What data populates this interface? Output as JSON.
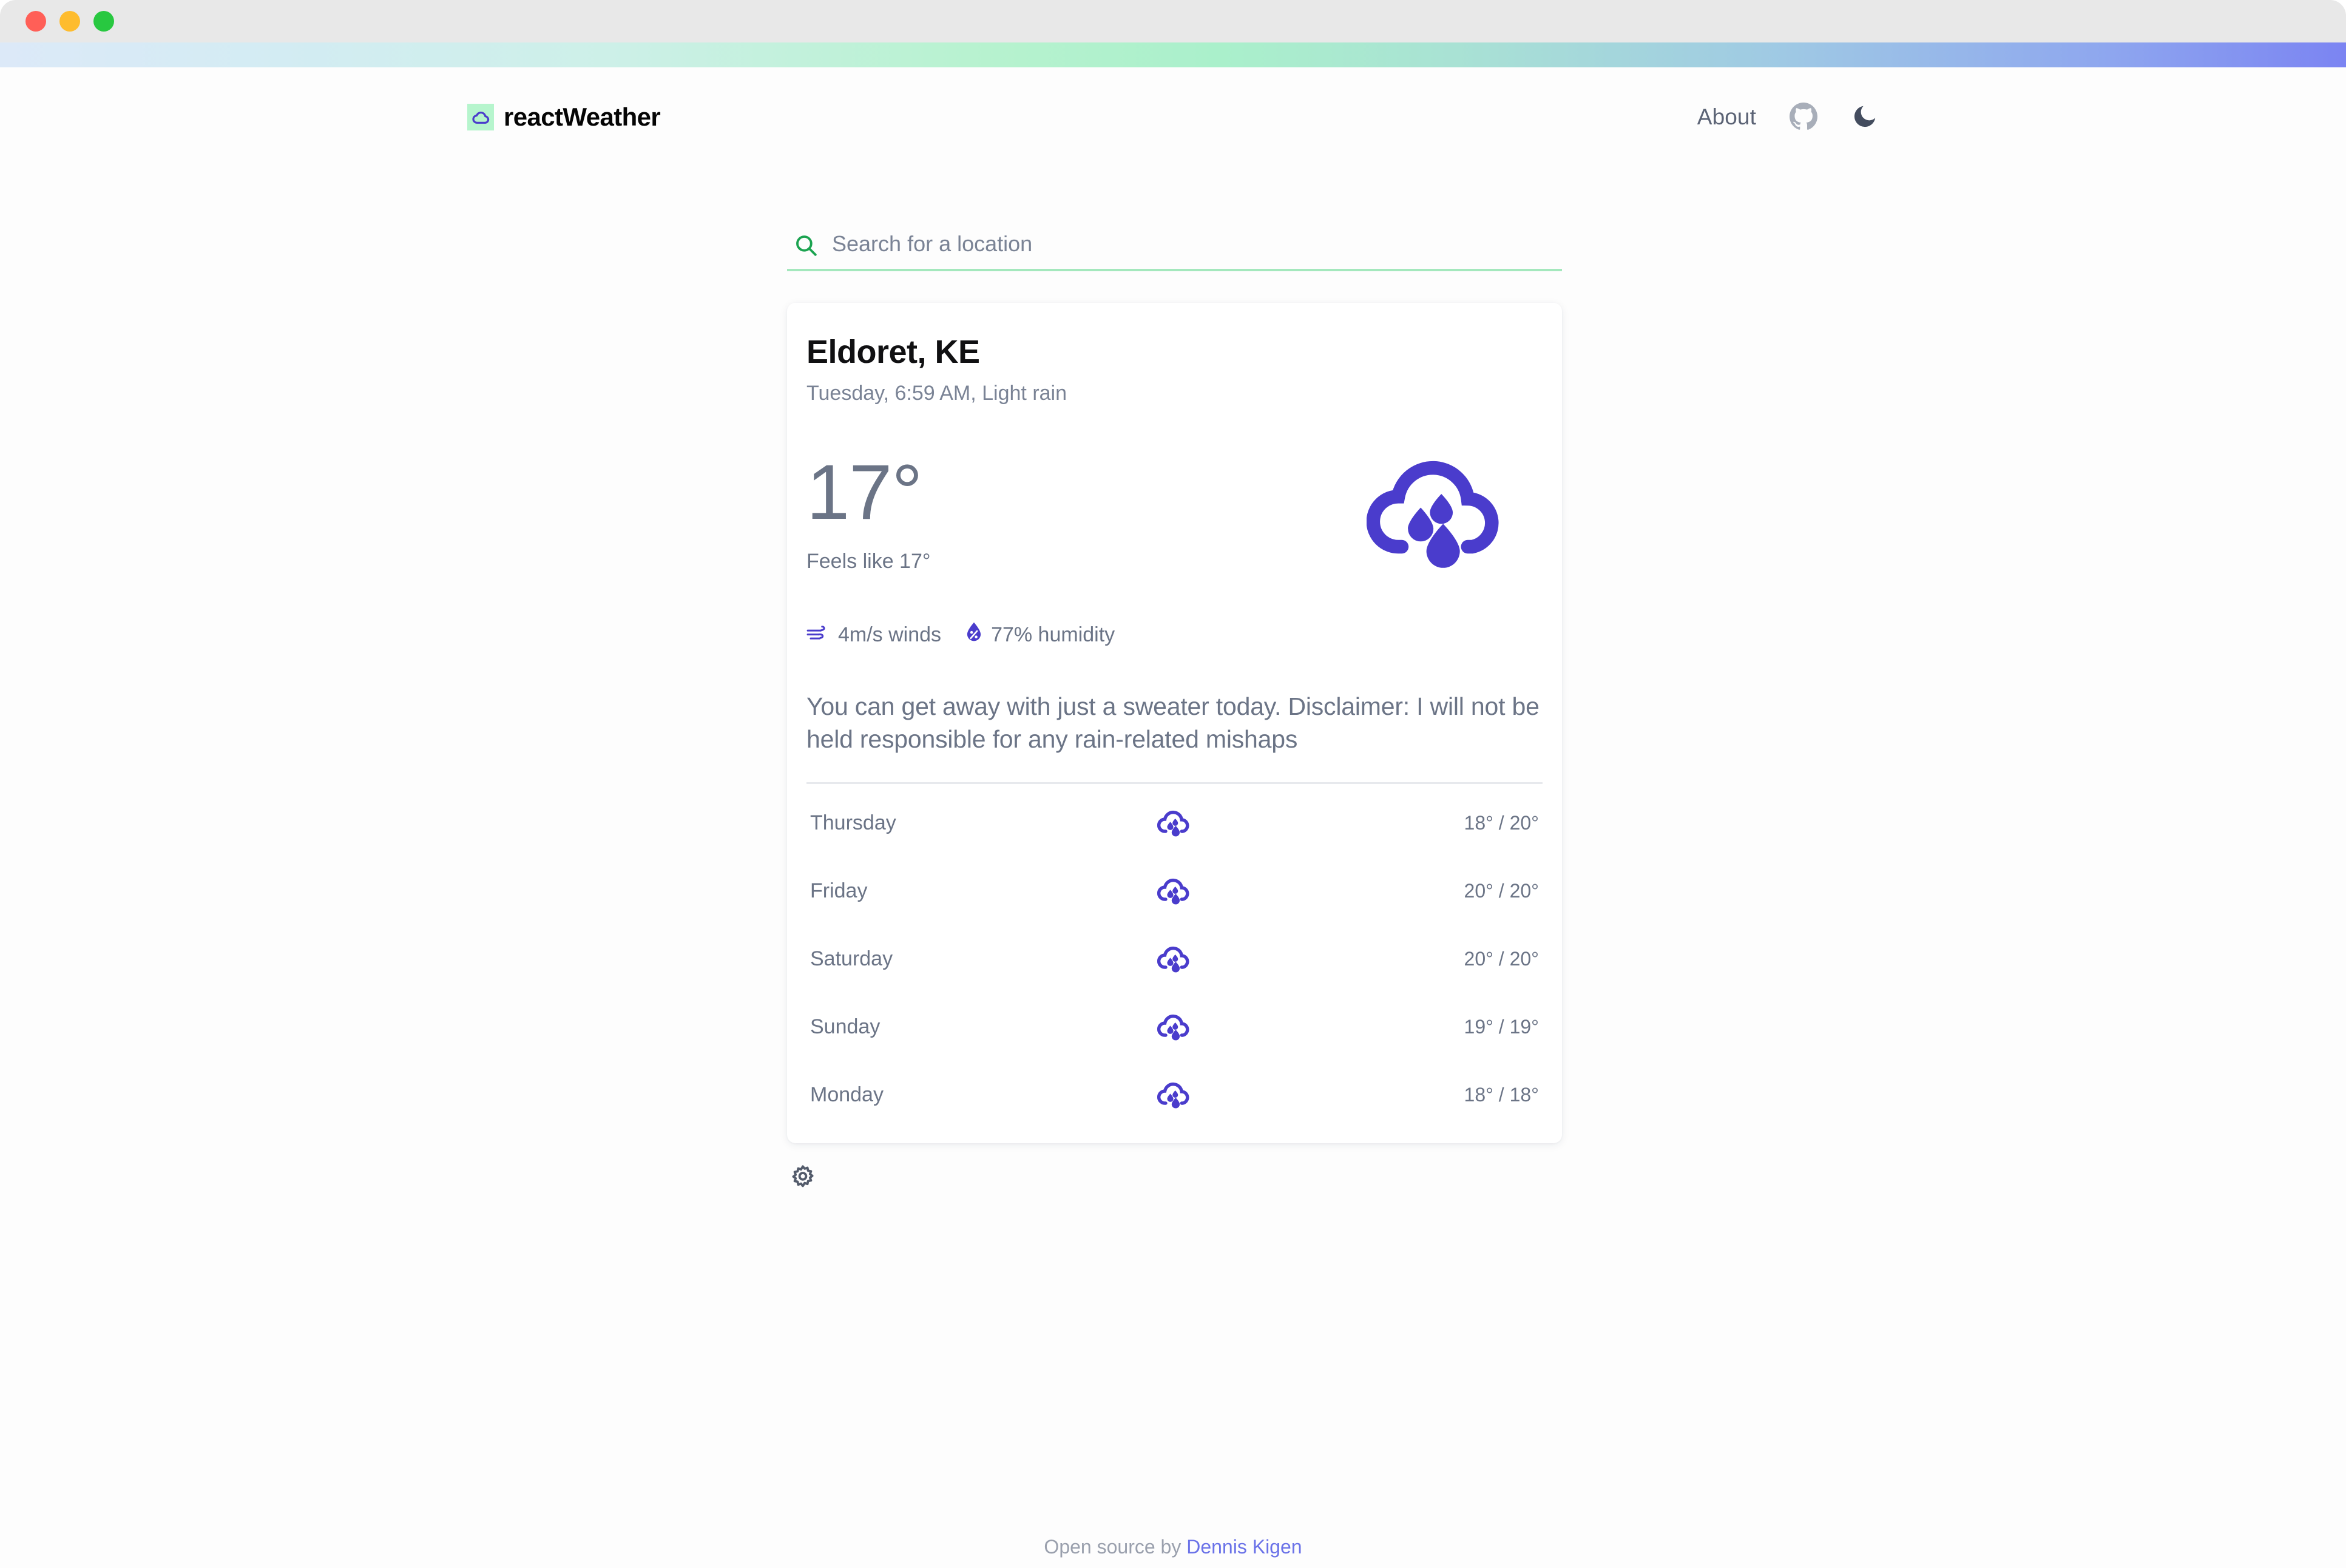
{
  "window": {
    "traffic_lights": [
      "close",
      "minimize",
      "zoom"
    ],
    "colors": {
      "close": "#ff5f57",
      "minimize": "#febc2e",
      "zoom": "#28c840"
    }
  },
  "theme": {
    "accent_green": "#a4e8bd",
    "brand_mark_bg": "#b6f5cd",
    "icon_indigo": "#4a3ccc",
    "search_icon_green": "#1ba350",
    "text_muted": "#6b7486",
    "link_indigo": "#6a72e8"
  },
  "header": {
    "brand_name": "reactWeather",
    "brand_icon": "cloud-icon",
    "nav": {
      "about_label": "About",
      "github_icon": "github-icon",
      "dark_mode_icon": "moon-icon"
    }
  },
  "search": {
    "placeholder": "Search for a location",
    "value": "",
    "icon": "search-icon"
  },
  "current": {
    "location": "Eldoret, KE",
    "subtitle": "Tuesday, 6:59 AM, Light rain",
    "temperature": "17°",
    "feels_like": "Feels like 17°",
    "condition_icon": "cloud-rain-icon",
    "wind": {
      "icon": "wind-icon",
      "label": "4m/s winds"
    },
    "humidity": {
      "icon": "humidity-droplet-icon",
      "label": "77% humidity"
    },
    "advice": "You can get away with just a sweater today. Disclaimer: I will not be held responsible for any rain-related mishaps"
  },
  "forecast": [
    {
      "day": "Thursday",
      "icon": "cloud-rain-icon",
      "temps": "18° / 20°"
    },
    {
      "day": "Friday",
      "icon": "cloud-rain-icon",
      "temps": "20° / 20°"
    },
    {
      "day": "Saturday",
      "icon": "cloud-rain-icon",
      "temps": "20° / 20°"
    },
    {
      "day": "Sunday",
      "icon": "cloud-rain-icon",
      "temps": "19° / 19°"
    },
    {
      "day": "Monday",
      "icon": "cloud-rain-icon",
      "temps": "18° / 18°"
    }
  ],
  "settings": {
    "icon": "gear-icon"
  },
  "footer": {
    "prefix": "Open source by ",
    "author": "Dennis Kigen"
  }
}
